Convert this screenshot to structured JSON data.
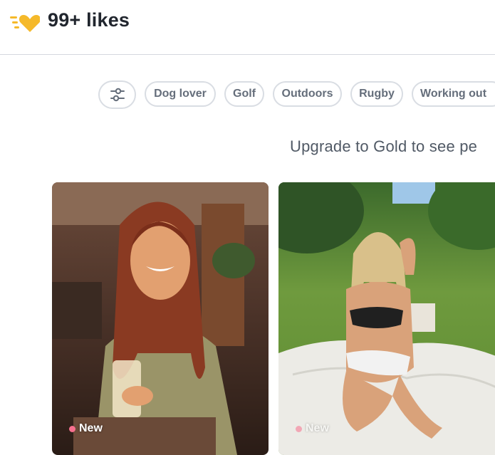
{
  "header": {
    "title": "99+ likes",
    "logo_icon": "gold-heart-icon",
    "accent": "#f5b92a"
  },
  "interests": {
    "filter_icon": "sliders-icon",
    "chips": [
      "Dog lover",
      "Golf",
      "Outdoors",
      "Rugby",
      "Working out"
    ]
  },
  "upgrade_text": "Upgrade to Gold to see pe",
  "cards": [
    {
      "badge": "New",
      "badge_color": "#f7708e"
    },
    {
      "badge": "New",
      "badge_color": "#f7708e"
    }
  ]
}
